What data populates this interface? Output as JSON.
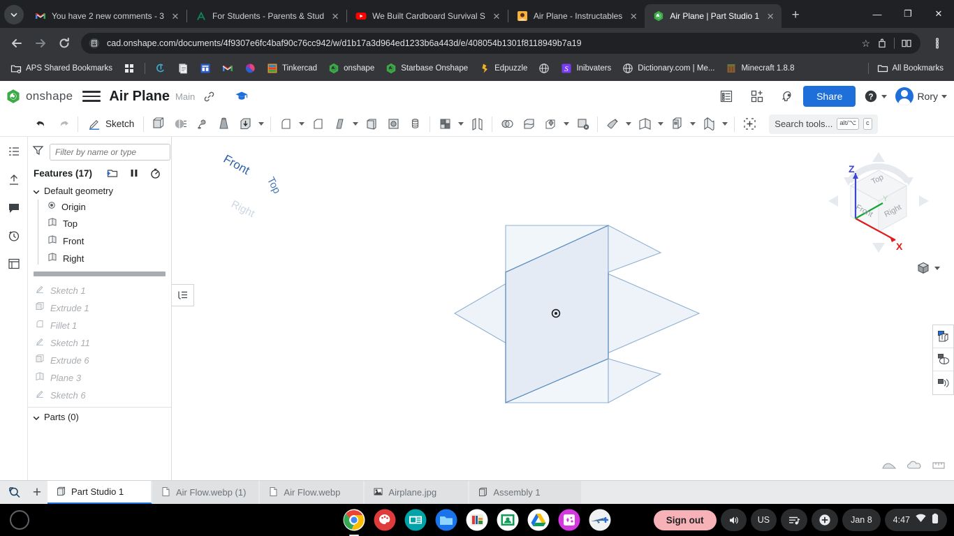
{
  "browser": {
    "tabs": [
      {
        "title": "You have 2 new comments - 3",
        "favicon": "gmail-icon",
        "active": false
      },
      {
        "title": "For Students - Parents & Stud",
        "favicon": "aspen-icon",
        "active": false
      },
      {
        "title": "We Built Cardboard Survival S",
        "favicon": "youtube-icon",
        "active": false
      },
      {
        "title": "Air Plane - Instructables",
        "favicon": "instructables-icon",
        "active": false
      },
      {
        "title": "Air Plane | Part Studio 1",
        "favicon": "onshape-icon",
        "active": true
      }
    ],
    "new_tab_label": "+",
    "window_controls": {
      "minimize": "—",
      "maximize": "❐",
      "close": "✕"
    },
    "omnibox": {
      "url": "cad.onshape.com/documents/4f9307e6fc4baf90c76cc942/w/d1b17a3d964ed1233b6a443d/e/408054b1301f8118949b7a19",
      "site_icon": "page-info-icon",
      "star": "☆"
    },
    "bookmarks": [
      {
        "label": "APS Shared Bookmarks",
        "icon": "folder-settings-icon"
      },
      {
        "label": "",
        "icon": "apps-grid-icon"
      },
      {
        "label": "",
        "icon": "teal-swirl-icon"
      },
      {
        "label": "",
        "icon": "docs-icon"
      },
      {
        "label": "",
        "icon": "blue-dashboard-icon"
      },
      {
        "label": "",
        "icon": "gmail-icon"
      },
      {
        "label": "",
        "icon": "pink-swirl-icon"
      },
      {
        "label": "Tinkercad",
        "icon": "tinkercad-icon"
      },
      {
        "label": "onshape",
        "icon": "onshape-icon"
      },
      {
        "label": "Starbase Onshape",
        "icon": "onshape-icon"
      },
      {
        "label": "Edpuzzle",
        "icon": "edpuzzle-icon"
      },
      {
        "label": "",
        "icon": "globe-icon"
      },
      {
        "label": "Inibvaters",
        "icon": "scratch-s-icon"
      },
      {
        "label": "Dictionary.com | Me...",
        "icon": "globe-icon"
      },
      {
        "label": "Minecraft 1.8.8",
        "icon": "minecraft-icon"
      }
    ],
    "all_bookmarks_label": "All Bookmarks"
  },
  "onshape": {
    "brand": "onshape",
    "document_title": "Air Plane",
    "branch": "Main",
    "share_label": "Share",
    "user_name": "Rory",
    "header_icons": [
      "link-icon",
      "graduation-cap-icon",
      "release-list-icon",
      "add-app-icon",
      "ai-assistant-icon"
    ],
    "toolbar": {
      "undo": "undo-icon",
      "redo": "redo-icon",
      "sketch_label": "Sketch",
      "search_placeholder": "Search tools...",
      "shortcut_alt": "alt/⌥",
      "shortcut_key": "c"
    },
    "tree": {
      "filter_placeholder": "Filter by name or type",
      "features_label": "Features (17)",
      "default_geometry_label": "Default geometry",
      "default_geometry_items": [
        {
          "label": "Origin",
          "icon": "origin-icon"
        },
        {
          "label": "Top",
          "icon": "plane-icon"
        },
        {
          "label": "Front",
          "icon": "plane-icon"
        },
        {
          "label": "Right",
          "icon": "plane-icon"
        }
      ],
      "rolled_features": [
        {
          "label": "Sketch 1",
          "icon": "sketch-icon"
        },
        {
          "label": "Extrude 1",
          "icon": "extrude-icon"
        },
        {
          "label": "Fillet 1",
          "icon": "fillet-icon"
        },
        {
          "label": "Sketch 11",
          "icon": "sketch-icon"
        },
        {
          "label": "Extrude 6",
          "icon": "extrude-icon"
        },
        {
          "label": "Plane 3",
          "icon": "plane-icon"
        },
        {
          "label": "Sketch 6",
          "icon": "sketch-icon"
        }
      ],
      "parts_label": "Parts (0)"
    },
    "viewport": {
      "plane_labels": [
        "Front",
        "Top",
        "Right"
      ],
      "origin_marker": "origin-point",
      "plane_fill": "#e8eff7",
      "plane_stroke": "#7aa3ce"
    },
    "viewcube": {
      "faces": [
        "Top",
        "Front",
        "Right"
      ],
      "axes": [
        {
          "label": "Z",
          "color": "#3b46d6"
        },
        {
          "label": "X",
          "color": "#e01b1b"
        },
        {
          "label": "Y",
          "color": "#12a633"
        }
      ]
    },
    "right_tools": [
      "section-view-icon",
      "display-state-icon",
      "explode-view-icon"
    ],
    "bottom_tabs": [
      {
        "label": "Part Studio 1",
        "icon": "part-studio-icon",
        "active": true
      },
      {
        "label": "Air Flow.webp (1)",
        "icon": "file-icon",
        "active": false
      },
      {
        "label": "Air Flow.webp",
        "icon": "file-icon",
        "active": false
      },
      {
        "label": "Airplane.jpg",
        "icon": "image-icon",
        "active": false
      },
      {
        "label": "Assembly 1",
        "icon": "assembly-icon",
        "active": false
      }
    ],
    "bottom_search_icon": "search-tabs-icon",
    "bottom_add_label": "+"
  },
  "shelf": {
    "launcher": "launcher-icon",
    "apps": [
      {
        "name": "chrome-icon",
        "running": true
      },
      {
        "name": "paint-icon",
        "running": false
      },
      {
        "name": "news-icon",
        "running": false
      },
      {
        "name": "files-icon",
        "running": false
      },
      {
        "name": "library-icon",
        "running": false
      },
      {
        "name": "classroom-icon",
        "running": false
      },
      {
        "name": "drive-icon",
        "running": false
      },
      {
        "name": "photos-icon",
        "running": false
      },
      {
        "name": "plane-app-icon",
        "running": false
      }
    ],
    "sign_out_label": "Sign out",
    "volume_icon": "volume-icon",
    "keyboard_label": "US",
    "media_icon": "media-icon",
    "accessibility_icon": "accessibility-icon",
    "date": "Jan 8",
    "time": "4:47",
    "wifi_icon": "wifi-icon",
    "battery_icon": "battery-icon"
  },
  "colors": {
    "chrome_toolbar": "#35363a",
    "chrome_tabstrip": "#202124",
    "onshape_blue": "#1e6fd9",
    "onshape_green": "#3aab46",
    "signout_pink": "#f7b2b7"
  }
}
